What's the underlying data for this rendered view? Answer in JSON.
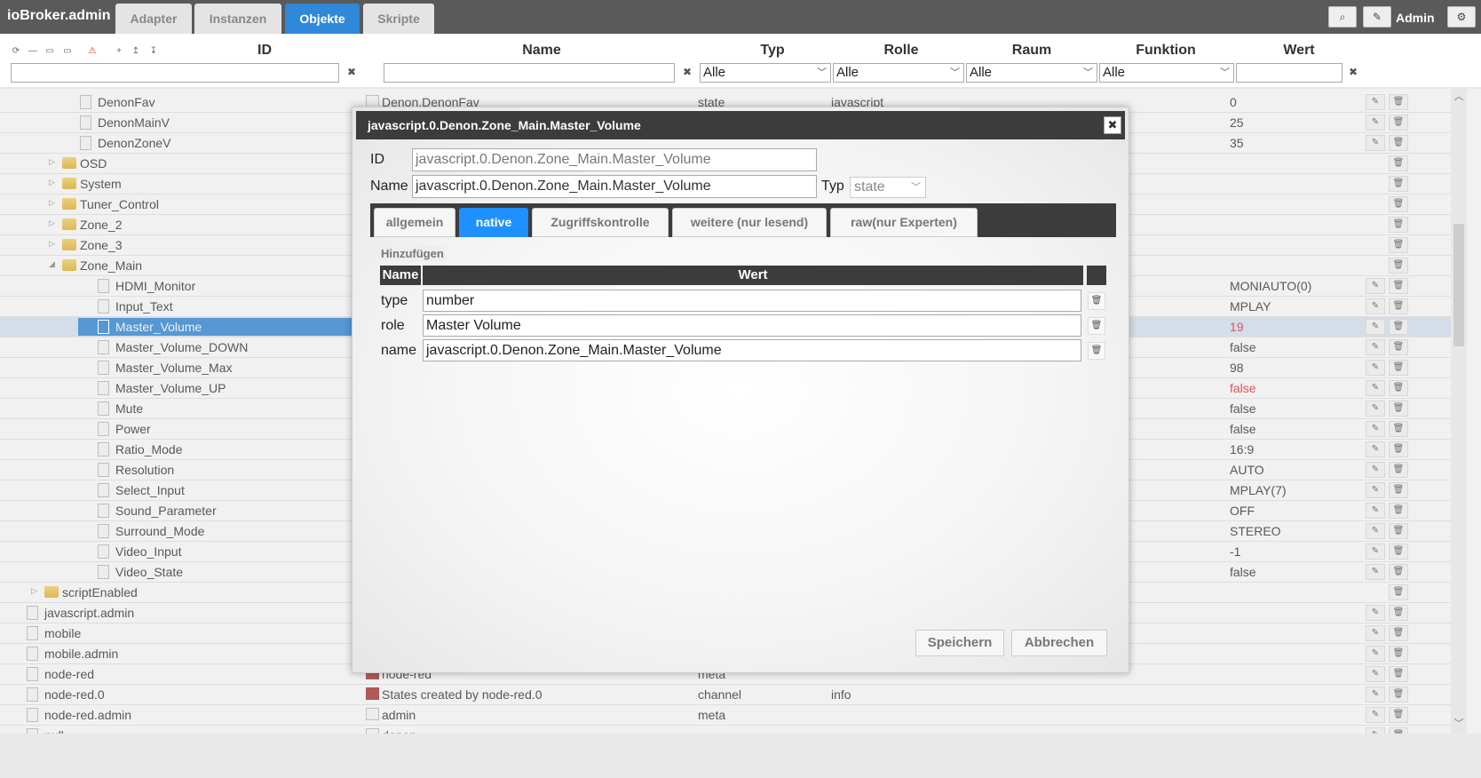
{
  "app": {
    "title": "ioBroker.admin",
    "user": "Admin"
  },
  "top_tabs": [
    {
      "label": "Adapter"
    },
    {
      "label": "Instanzen"
    },
    {
      "label": "Objekte",
      "active": true
    },
    {
      "label": "Skripte"
    }
  ],
  "top_buttons": {
    "search_icon": "⌕",
    "edit_icon": "✎",
    "settings_icon": "⚙"
  },
  "columns": {
    "id": "ID",
    "name": "Name",
    "typ": "Typ",
    "rolle": "Rolle",
    "raum": "Raum",
    "funktion": "Funktion",
    "wert": "Wert"
  },
  "filters": {
    "typ": "Alle",
    "rolle": "Alle",
    "raum": "Alle",
    "funktion": "Alle",
    "clear": "✖"
  },
  "tree_icons": [
    "⟳",
    "—",
    "▭",
    "▭",
    "⚠",
    "+",
    "↥",
    "↧"
  ],
  "tree": [
    {
      "label": "DenonFav",
      "kind": "file",
      "depth": 3,
      "value": "0",
      "edit": true
    },
    {
      "label": "DenonMainV",
      "kind": "file",
      "depth": 3,
      "value": "25",
      "edit": true
    },
    {
      "label": "DenonZoneV",
      "kind": "file",
      "depth": 3,
      "value": "35",
      "edit": true
    },
    {
      "label": "OSD",
      "kind": "folder",
      "depth": 2,
      "expand": "▷",
      "value": "",
      "edit": false
    },
    {
      "label": "System",
      "kind": "folder",
      "depth": 2,
      "expand": "▷",
      "value": "",
      "edit": false
    },
    {
      "label": "Tuner_Control",
      "kind": "folder",
      "depth": 2,
      "expand": "▷",
      "value": "",
      "edit": false
    },
    {
      "label": "Zone_2",
      "kind": "folder",
      "depth": 2,
      "expand": "▷",
      "value": "",
      "edit": false
    },
    {
      "label": "Zone_3",
      "kind": "folder",
      "depth": 2,
      "expand": "▷",
      "value": "",
      "edit": false
    },
    {
      "label": "Zone_Main",
      "kind": "folder",
      "depth": 2,
      "expand": "◢",
      "value": "",
      "edit": false
    },
    {
      "label": "HDMI_Monitor",
      "kind": "file",
      "depth": 4,
      "value": "MONIAUTO(0)",
      "edit": true
    },
    {
      "label": "Input_Text",
      "kind": "file",
      "depth": 4,
      "value": "MPLAY",
      "edit": true
    },
    {
      "label": "Master_Volume",
      "kind": "file",
      "depth": 4,
      "value": "19",
      "red": true,
      "selected": true,
      "edit": true
    },
    {
      "label": "Master_Volume_DOWN",
      "kind": "file",
      "depth": 4,
      "value": "false",
      "edit": true
    },
    {
      "label": "Master_Volume_Max",
      "kind": "file",
      "depth": 4,
      "value": "98",
      "edit": true
    },
    {
      "label": "Master_Volume_UP",
      "kind": "file",
      "depth": 4,
      "value": "false",
      "red": true,
      "edit": true
    },
    {
      "label": "Mute",
      "kind": "file",
      "depth": 4,
      "value": "false",
      "edit": true
    },
    {
      "label": "Power",
      "kind": "file",
      "depth": 4,
      "value": "false",
      "edit": true
    },
    {
      "label": "Ratio_Mode",
      "kind": "file",
      "depth": 4,
      "value": "16:9",
      "edit": true
    },
    {
      "label": "Resolution",
      "kind": "file",
      "depth": 4,
      "value": "AUTO",
      "edit": true
    },
    {
      "label": "Select_Input",
      "kind": "file",
      "depth": 4,
      "value": "MPLAY(7)",
      "edit": true
    },
    {
      "label": "Sound_Parameter",
      "kind": "file",
      "depth": 4,
      "value": "OFF",
      "edit": true
    },
    {
      "label": "Surround_Mode",
      "kind": "file",
      "depth": 4,
      "value": "STEREO",
      "edit": true
    },
    {
      "label": "Video_Input",
      "kind": "file",
      "depth": 4,
      "value": "-1",
      "edit": true
    },
    {
      "label": "Video_State",
      "kind": "file",
      "depth": 4,
      "value": "false",
      "edit": true
    },
    {
      "label": "scriptEnabled",
      "kind": "folder",
      "depth": 1,
      "expand": "▷",
      "value": "",
      "edit": false
    },
    {
      "label": "javascript.admin",
      "kind": "file",
      "depth": 0,
      "value": "",
      "edit": true
    },
    {
      "label": "mobile",
      "kind": "file",
      "depth": 0,
      "value": "",
      "edit": true
    },
    {
      "label": "mobile.admin",
      "kind": "file",
      "depth": 0,
      "value": "",
      "edit": true
    },
    {
      "label": "node-red",
      "kind": "file",
      "depth": 0,
      "value": "",
      "edit": true
    },
    {
      "label": "node-red.0",
      "kind": "file",
      "depth": 0,
      "value": "",
      "edit": true
    },
    {
      "label": "node-red.admin",
      "kind": "file",
      "depth": 0,
      "value": "",
      "edit": true
    },
    {
      "label": "null",
      "kind": "file",
      "depth": 0,
      "value": "",
      "edit": true
    }
  ],
  "background_rows": {
    "first": {
      "name": "Denon.DenonFav",
      "typ": "state",
      "rolle": "javascript"
    },
    "node_red": {
      "name": "node-red",
      "typ": "meta"
    },
    "node_red_0": {
      "name": "States created by node-red.0",
      "typ": "channel",
      "rolle": "info"
    },
    "node_red_admin": {
      "name": "admin",
      "typ": "meta"
    },
    "null_row": {
      "name": "denon"
    }
  },
  "row_icons": {
    "edit": "✎",
    "delete": "🗑"
  },
  "dialog": {
    "title": "javascript.0.Denon.Zone_Main.Master_Volume",
    "close": "✖",
    "id_label": "ID",
    "id_value": "javascript.0.Denon.Zone_Main.Master_Volume",
    "name_label": "Name",
    "name_value": "javascript.0.Denon.Zone_Main.Master_Volume",
    "typ_label": "Typ",
    "typ_value": "state",
    "tabs": [
      {
        "label": "allgemein"
      },
      {
        "label": "native",
        "active": true
      },
      {
        "label": "Zugriffskontrolle"
      },
      {
        "label": "weitere (nur lesend)"
      },
      {
        "label": "raw(nur Experten)"
      }
    ],
    "add_label": "Hinzufügen",
    "table_head": {
      "name": "Name",
      "wert": "Wert"
    },
    "native_rows": [
      {
        "name": "type",
        "value": "number"
      },
      {
        "name": "role",
        "value": "Master Volume"
      },
      {
        "name": "name",
        "value": "javascript.0.Denon.Zone_Main.Master_Volume"
      }
    ],
    "save_label": "Speichern",
    "cancel_label": "Abbrechen"
  }
}
